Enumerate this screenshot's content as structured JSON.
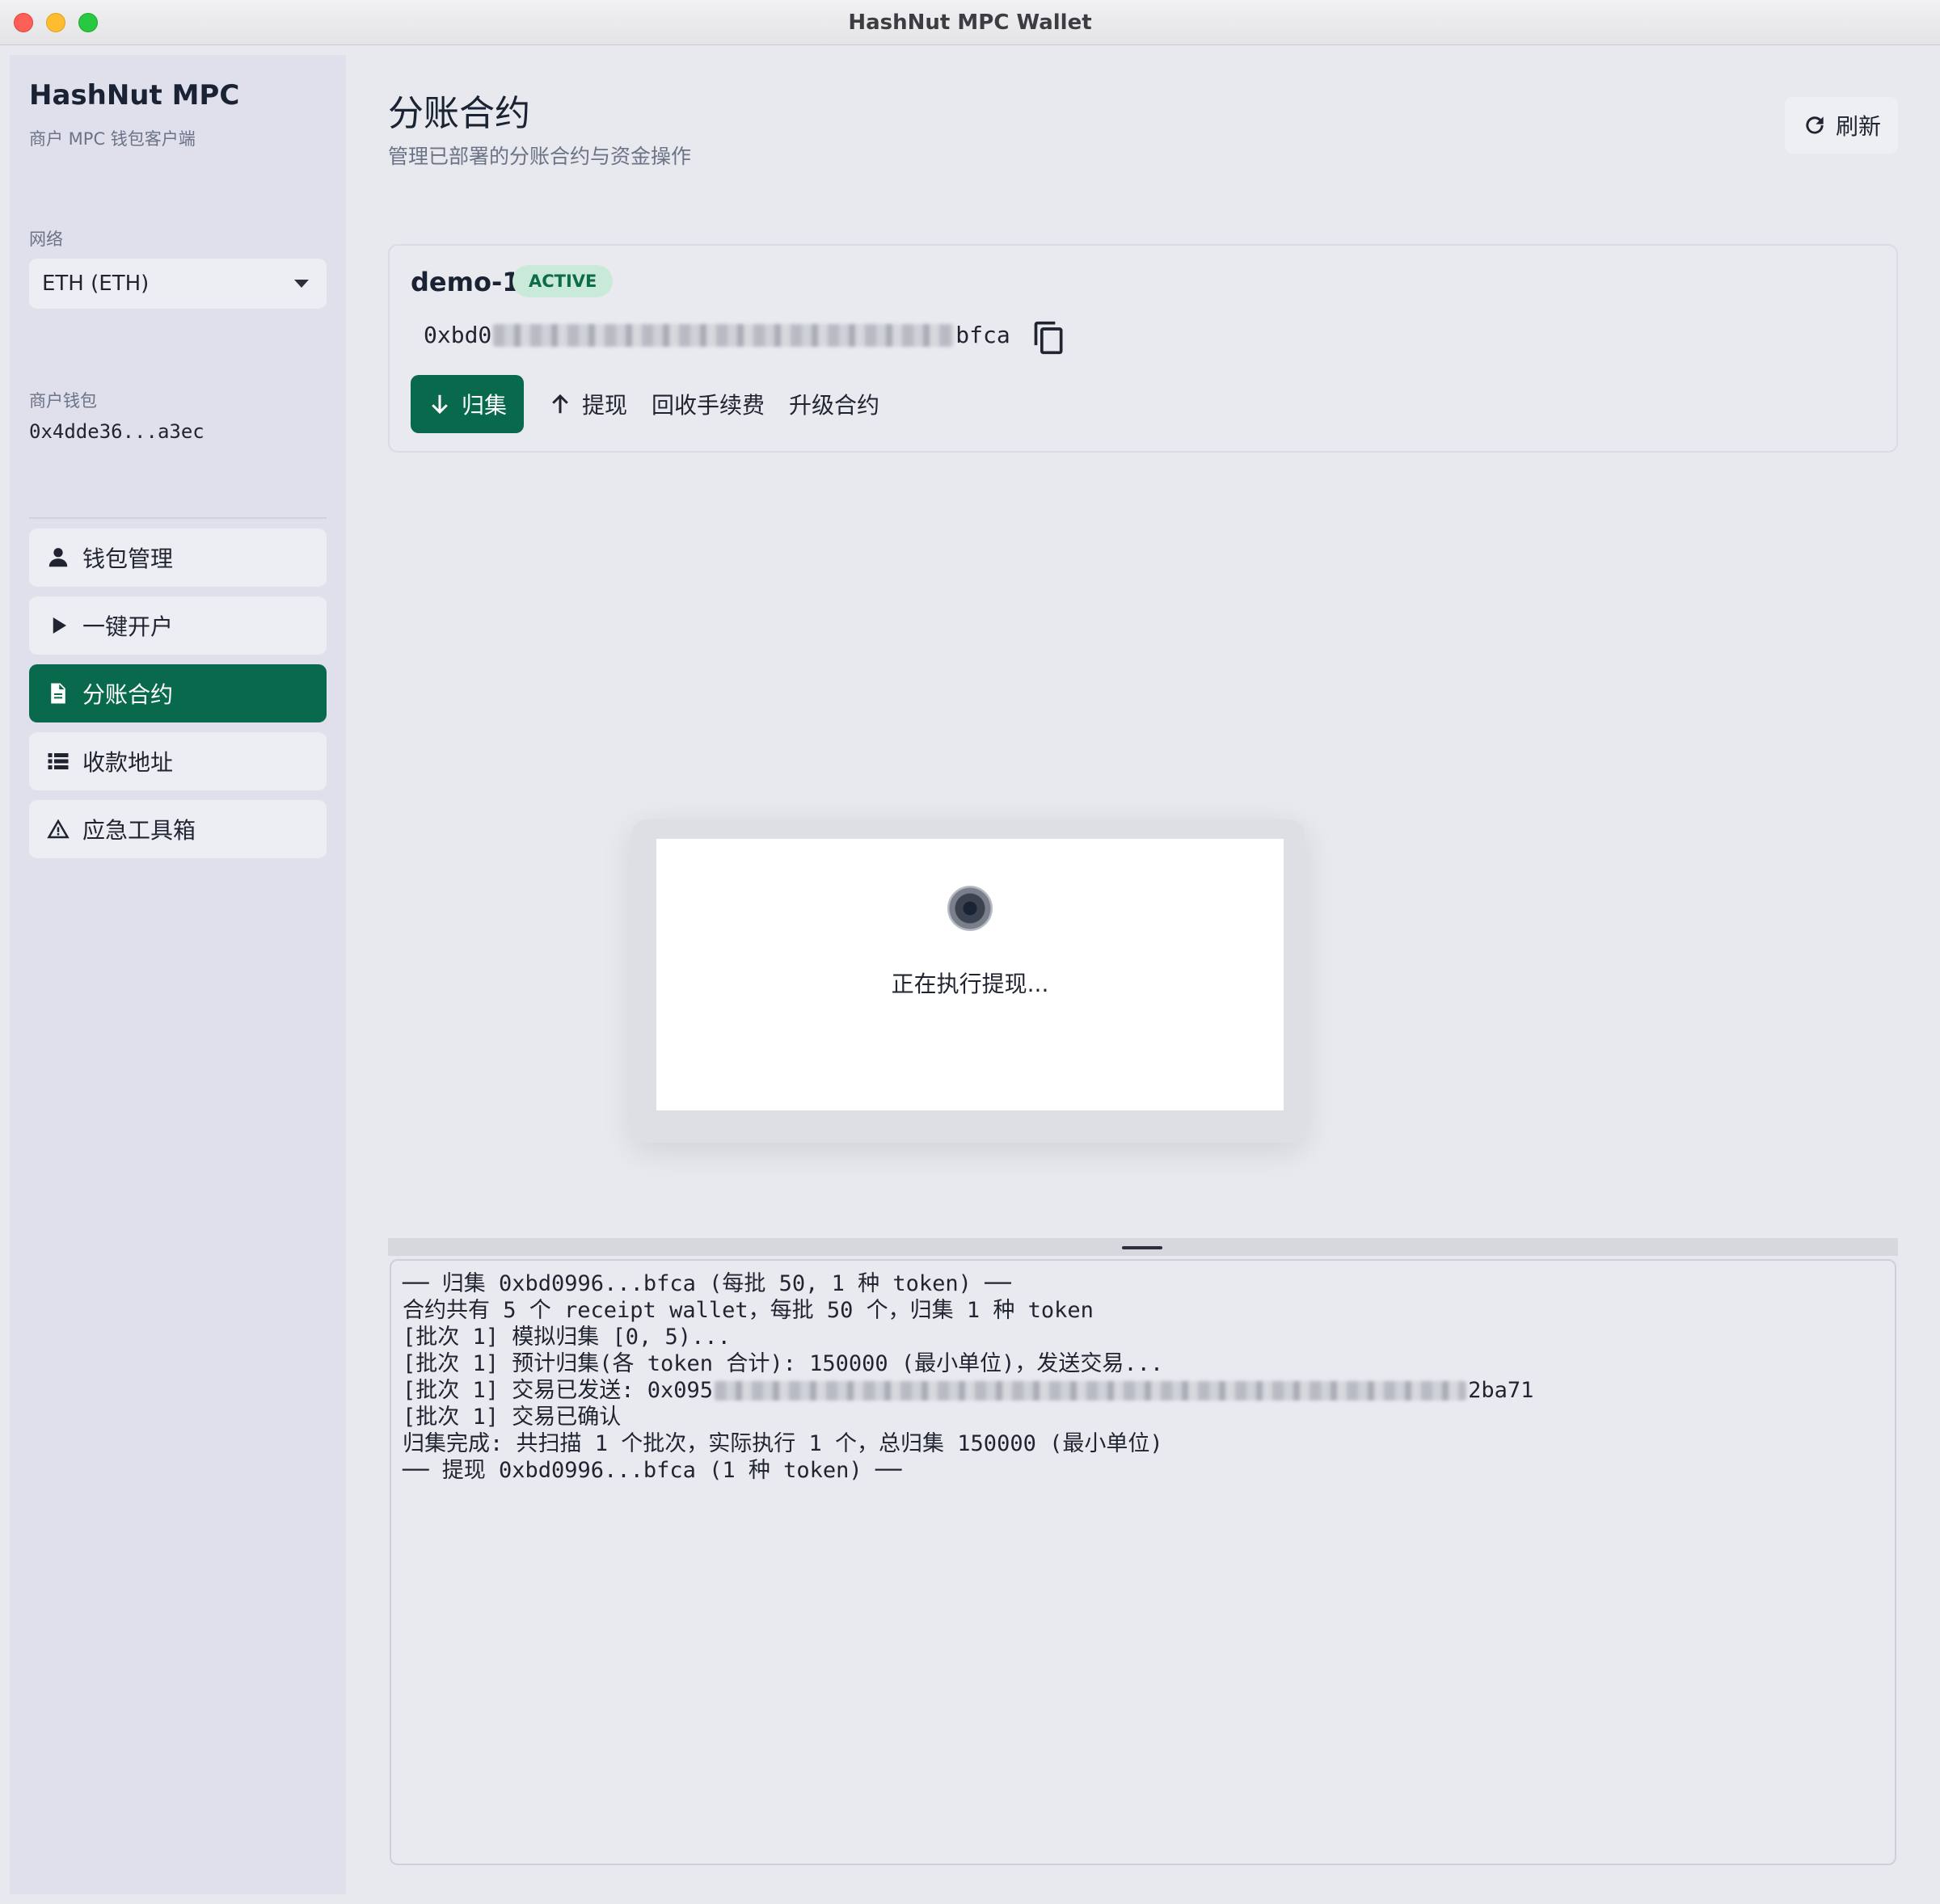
{
  "window": {
    "title": "HashNut MPC Wallet"
  },
  "sidebar": {
    "brand": "HashNut MPC",
    "brand_sub": "商户 MPC 钱包客户端",
    "network_label": "网络",
    "network_value": "ETH (ETH)",
    "wallet_label": "商户钱包",
    "wallet_address": "0x4dde36...a3ec",
    "items": [
      {
        "label": "钱包管理",
        "icon": "user-icon",
        "active": false
      },
      {
        "label": "一键开户",
        "icon": "play-icon",
        "active": false
      },
      {
        "label": "分账合约",
        "icon": "document-icon",
        "active": true
      },
      {
        "label": "收款地址",
        "icon": "list-icon",
        "active": false
      },
      {
        "label": "应急工具箱",
        "icon": "warning-icon",
        "active": false
      }
    ]
  },
  "header": {
    "title": "分账合约",
    "subtitle": "管理已部署的分账合约与资金操作",
    "refresh_label": "刷新"
  },
  "contract": {
    "name": "demo-1",
    "status": "ACTIVE",
    "address_prefix": "0xbd0",
    "address_suffix": "bfca",
    "actions": {
      "collect": "归集",
      "withdraw": "提现",
      "reclaim_fee": "回收手续费",
      "upgrade": "升级合约"
    }
  },
  "modal": {
    "message": "正在执行提现..."
  },
  "log": {
    "lines": [
      "── 归集 0xbd0996...bfca (每批 50, 1 种 token) ──",
      "合约共有 5 个 receipt wallet，每批 50 个，归集 1 种 token",
      "[批次 1] 模拟归集 [0, 5)...",
      "[批次 1] 预计归集(各 token 合计): 150000 (最小单位)，发送交易...",
      "[批次 1] 交易已确认",
      "归集完成: 共扫描 1 个批次，实际执行 1 个，总归集 150000 (最小单位)",
      "── 提现 0xbd0996...bfca (1 种 token) ──"
    ],
    "tx_line_prefix": "[批次 1] 交易已发送: 0x095",
    "tx_line_suffix": "2ba71"
  },
  "colors": {
    "accent": "#08694d",
    "badge_bg": "#c9ead8",
    "badge_text": "#0d6b45",
    "sidebar_bg": "#dfe0ec",
    "main_bg": "#e8e9ee"
  }
}
